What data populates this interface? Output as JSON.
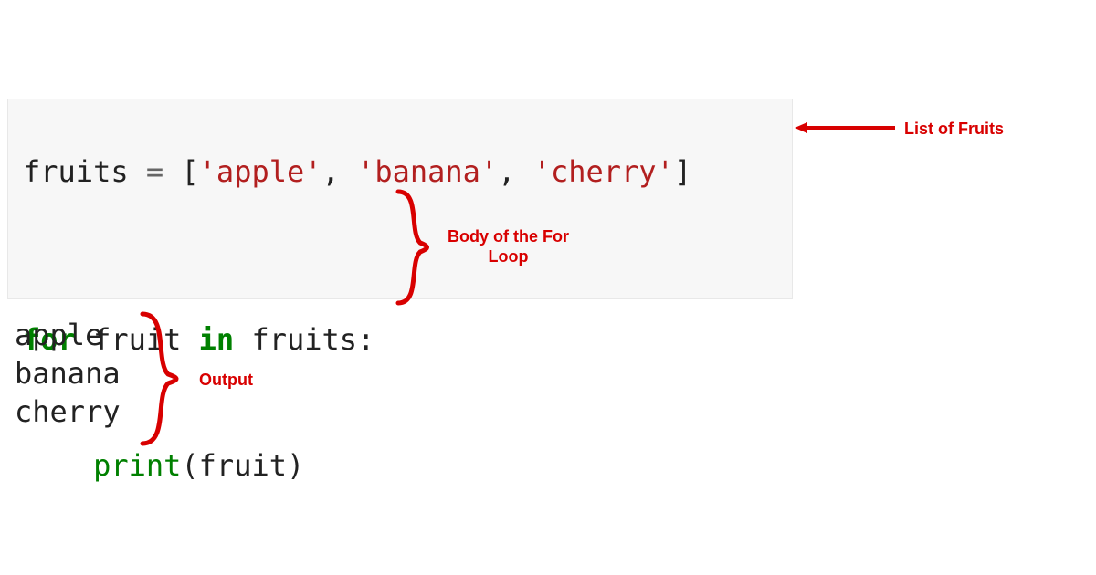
{
  "code": {
    "line1": {
      "var": "fruits",
      "op": " = ",
      "open": "[",
      "s1": "'apple'",
      "c1": ", ",
      "s2": "'banana'",
      "c2": ", ",
      "s3": "'cherry'",
      "close": "]"
    },
    "line3": {
      "kw_for": "for",
      "sp1": " ",
      "var1": "fruit",
      "sp2": " ",
      "kw_in": "in",
      "sp3": " ",
      "var2": "fruits",
      "colon": ":"
    },
    "line4": {
      "indent": "    ",
      "func": "print",
      "open": "(",
      "arg": "fruit",
      "close": ")"
    }
  },
  "output": {
    "o1": "apple",
    "o2": "banana",
    "o3": "cherry"
  },
  "annotations": {
    "list_label": "List of Fruits",
    "body_label_l1": "Body of the For",
    "body_label_l2": "Loop",
    "output_label": "Output"
  },
  "colors": {
    "accent": "#d80000"
  }
}
